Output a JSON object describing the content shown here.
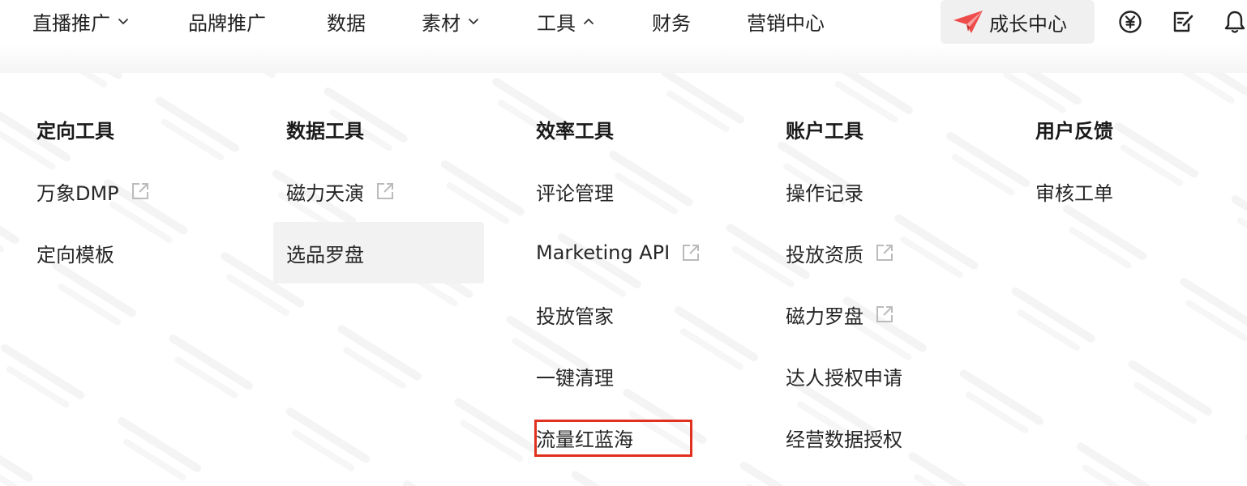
{
  "nav": {
    "items": [
      {
        "label": "直播推广",
        "has_chevron": true,
        "chevron": "down"
      },
      {
        "label": "品牌推广",
        "has_chevron": false
      },
      {
        "label": "数据",
        "has_chevron": false
      },
      {
        "label": "素材",
        "has_chevron": true,
        "chevron": "down"
      },
      {
        "label": "工具",
        "has_chevron": true,
        "chevron": "up"
      },
      {
        "label": "财务",
        "has_chevron": false
      },
      {
        "label": "营销中心",
        "has_chevron": false
      }
    ],
    "growth_center": {
      "label": "成长中心",
      "icon": "paper-plane-icon"
    },
    "right_icons": [
      "yuan-circle-icon",
      "edit-note-icon",
      "bell-icon"
    ]
  },
  "menu": {
    "columns": [
      {
        "title": "定向工具",
        "items": [
          {
            "label": "万象DMP",
            "external": true
          },
          {
            "label": "定向模板",
            "external": false
          }
        ]
      },
      {
        "title": "数据工具",
        "items": [
          {
            "label": "磁力天演",
            "external": true
          },
          {
            "label": "选品罗盘",
            "external": false,
            "hovered": true
          }
        ]
      },
      {
        "title": "效率工具",
        "items": [
          {
            "label": "评论管理",
            "external": false
          },
          {
            "label": "Marketing API",
            "external": true
          },
          {
            "label": "投放管家",
            "external": false
          },
          {
            "label": "一键清理",
            "external": false
          },
          {
            "label": "流量红蓝海",
            "external": false,
            "annotated": true
          }
        ]
      },
      {
        "title": "账户工具",
        "items": [
          {
            "label": "操作记录",
            "external": false
          },
          {
            "label": "投放资质",
            "external": true
          },
          {
            "label": "磁力罗盘",
            "external": true
          },
          {
            "label": "达人授权申请",
            "external": false
          },
          {
            "label": "经营数据授权",
            "external": false
          }
        ]
      },
      {
        "title": "用户反馈",
        "items": [
          {
            "label": "审核工单",
            "external": false
          }
        ]
      }
    ]
  },
  "colors": {
    "annotation_red": "#e0301e",
    "hover_bg": "#f2f2f2",
    "plane_red": "#ee4b4b"
  }
}
